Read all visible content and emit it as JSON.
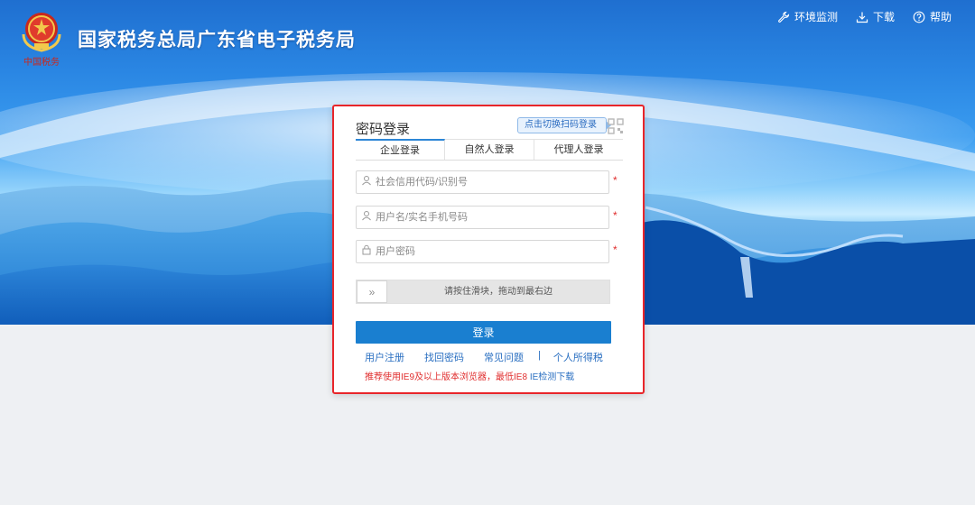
{
  "header": {
    "title": "国家税务总局广东省电子税务局",
    "logo_text": "中国税务",
    "links": [
      {
        "label": "环境监测",
        "icon": "wrench-icon"
      },
      {
        "label": "下载",
        "icon": "download-icon"
      },
      {
        "label": "帮助",
        "icon": "help-icon"
      }
    ]
  },
  "login": {
    "title": "密码登录",
    "qr_tip": "点击切换扫码登录",
    "tabs": [
      "企业登录",
      "自然人登录",
      "代理人登录"
    ],
    "active_tab": 0,
    "fields": {
      "credit_code_placeholder": "社会信用代码/识别号",
      "username_placeholder": "用户名/实名手机号码",
      "password_placeholder": "用户密码"
    },
    "required_mark": "*",
    "slider_text": "请按住滑块，拖动到最右边",
    "slider_handle": "»",
    "submit_label": "登录",
    "links": [
      "用户注册",
      "找回密码",
      "常见问题"
    ],
    "link_separator": "|",
    "personal_tax_link": "个人所得税",
    "notice_text": "推荐使用IE9及以上版本浏览器，最低IE8",
    "notice_link": "IE检测下载"
  },
  "colors": {
    "accent": "#1a7fd0",
    "card_border": "#e8252a",
    "required": "#e02d2d",
    "link": "#2a6fc1"
  }
}
